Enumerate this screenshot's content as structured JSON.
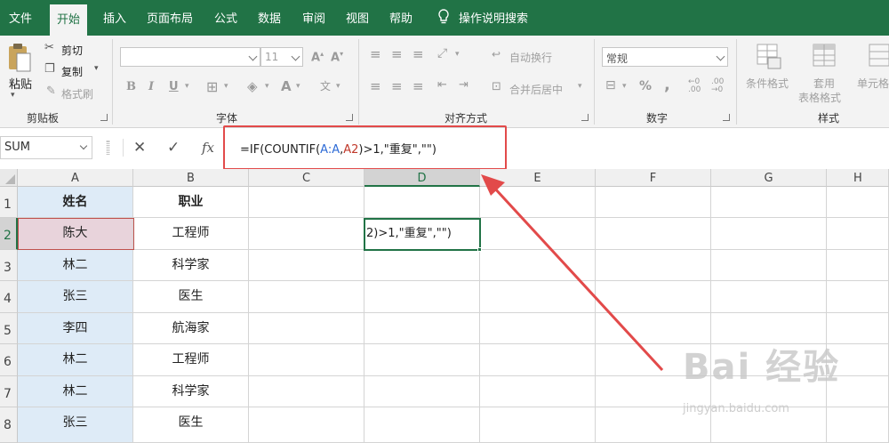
{
  "tabs": [
    "文件",
    "开始",
    "插入",
    "页面布局",
    "公式",
    "数据",
    "审阅",
    "视图",
    "帮助"
  ],
  "tell_me": "操作说明搜索",
  "clipboard": {
    "paste": "粘贴",
    "cut": "剪切",
    "copy": "复制",
    "format_painter": "格式刷",
    "group": "剪贴板"
  },
  "font": {
    "size": "11",
    "bold": "B",
    "italic": "I",
    "underline": "U",
    "font_color": "A",
    "group": "字体"
  },
  "alignment": {
    "wrap": "自动换行",
    "merge": "合并后居中",
    "group": "对齐方式"
  },
  "number": {
    "format": "常规",
    "percent": "%",
    "comma": ",",
    "group": "数字"
  },
  "styles": {
    "conditional": "条件格式",
    "table_format_1": "套用",
    "table_format_2": "表格格式",
    "cell_styles": "单元格",
    "group": "样式"
  },
  "namebox": "SUM",
  "fx": "fx",
  "formula": {
    "p1": "=IF(COUNTIF(",
    "p2": "A:A",
    "p3": ",",
    "p4": "A2",
    "p5": ")>1,\"重复\",\"\")"
  },
  "columns": [
    "A",
    "B",
    "C",
    "D",
    "E",
    "F",
    "G",
    "H"
  ],
  "rows": [
    "1",
    "2",
    "3",
    "4",
    "5",
    "6",
    "7",
    "8"
  ],
  "cells": [
    [
      "姓名",
      "职业"
    ],
    [
      "陈大",
      "工程师"
    ],
    [
      "林二",
      "科学家"
    ],
    [
      "张三",
      "医生"
    ],
    [
      "李四",
      "航海家"
    ],
    [
      "林二",
      "工程师"
    ],
    [
      "林二",
      "科学家"
    ],
    [
      "张三",
      "医生"
    ]
  ],
  "d2_text": "2)>1,\"重复\",\"\")",
  "watermark": "Bai 经验",
  "watermark_url": "jingyan.baidu.com",
  "colors": {
    "accent": "#217346",
    "highlight": "#e24a4a",
    "col_a_fill": "#deebf7"
  }
}
